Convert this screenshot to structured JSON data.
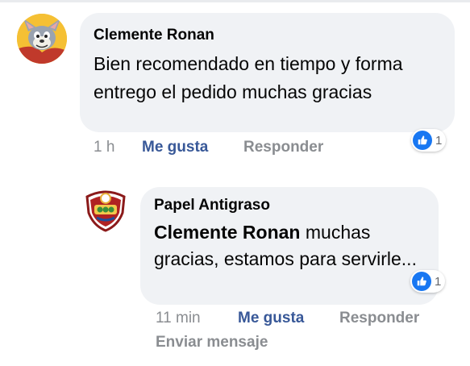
{
  "comment": {
    "author": "Clemente Ronan",
    "text": "Bien recomendado en tiempo y forma entrego el pedido muchas gracias",
    "time": "1 h",
    "like_label": "Me gusta",
    "reply_label": "Responder",
    "reaction_count": "1",
    "avatar_icon": "cartoon-cat-avatar"
  },
  "reply": {
    "author": "Papel Antigraso",
    "mention": "Clemente Ronan",
    "text": " muchas gracias, estamos para servirle...",
    "time": "11 min",
    "like_label": "Me gusta",
    "reply_label": "Responder",
    "message_label": "Enviar mensaje",
    "reaction_count": "1",
    "avatar_icon": "shield-logo-avatar"
  },
  "colors": {
    "bubble": "#f0f2f5",
    "like_blue": "#1877f2",
    "link": "#385898",
    "meta_gray": "#8a8d91"
  }
}
